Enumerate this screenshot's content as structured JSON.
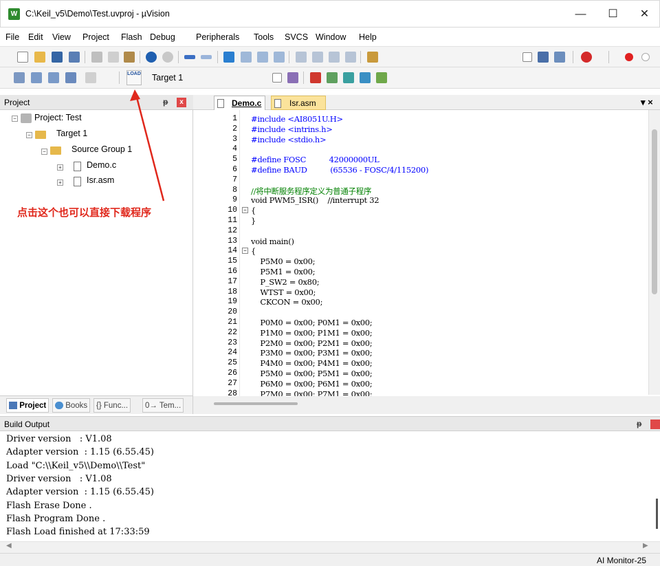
{
  "window": {
    "title": "C:\\Keil_v5\\Demo\\Test.uvproj - µVision",
    "app_icon_label": "W",
    "minimize": "—",
    "maximize": "☐",
    "close": "✕"
  },
  "menu": [
    "File",
    "Edit",
    "View",
    "Project",
    "Flash",
    "Debug",
    "Peripherals",
    "Tools",
    "SVCS",
    "Window",
    "Help"
  ],
  "toolbar2": {
    "load_icon_label": "LOAD",
    "target": "Target 1"
  },
  "project_panel": {
    "header": "Project",
    "pin": "ᵽ",
    "close": "x",
    "tree": {
      "project": "Project: Test",
      "target": "Target 1",
      "group": "Source Group 1",
      "files": [
        "Demo.c",
        "Isr.asm"
      ]
    },
    "tabs": [
      "Project",
      "Books",
      "{} Func...",
      "0→ Tem..."
    ]
  },
  "annotation": "点击这个也可以直接下载程序",
  "editor": {
    "tabs": [
      "Demo.c",
      "Isr.asm"
    ],
    "tab_menu": "▾ ×",
    "lines": [
      {
        "n": "1",
        "t": "#include <AI8051U.H>"
      },
      {
        "n": "2",
        "t": "#include <intrins.h>"
      },
      {
        "n": "3",
        "t": "#include <stdio.h>"
      },
      {
        "n": "4",
        "t": ""
      },
      {
        "n": "5",
        "t": "#define FOSC          42000000UL"
      },
      {
        "n": "6",
        "t": "#define BAUD          (65536 - FOSC/4/115200)"
      },
      {
        "n": "7",
        "t": ""
      },
      {
        "n": "8",
        "t": "//将中断服务程序定义为普通子程序"
      },
      {
        "n": "9",
        "t": "void PWM5_ISR()    //interrupt 32"
      },
      {
        "n": "10",
        "t": "{"
      },
      {
        "n": "11",
        "t": "}"
      },
      {
        "n": "12",
        "t": ""
      },
      {
        "n": "13",
        "t": "void main()"
      },
      {
        "n": "14",
        "t": "{"
      },
      {
        "n": "15",
        "t": "    P5M0 = 0x00;"
      },
      {
        "n": "16",
        "t": "    P5M1 = 0x00;"
      },
      {
        "n": "17",
        "t": "    P_SW2 = 0x80;"
      },
      {
        "n": "18",
        "t": "    WTST = 0x00;"
      },
      {
        "n": "19",
        "t": "    CKCON = 0x00;"
      },
      {
        "n": "20",
        "t": ""
      },
      {
        "n": "21",
        "t": "    P0M0 = 0x00; P0M1 = 0x00;"
      },
      {
        "n": "22",
        "t": "    P1M0 = 0x00; P1M1 = 0x00;"
      },
      {
        "n": "23",
        "t": "    P2M0 = 0x00; P2M1 = 0x00;"
      },
      {
        "n": "24",
        "t": "    P3M0 = 0x00; P3M1 = 0x00;"
      },
      {
        "n": "25",
        "t": "    P4M0 = 0x00; P4M1 = 0x00;"
      },
      {
        "n": "26",
        "t": "    P5M0 = 0x00; P5M1 = 0x00;"
      },
      {
        "n": "27",
        "t": "    P6M0 = 0x00; P6M1 = 0x00;"
      },
      {
        "n": "28",
        "t": "    P7M0 = 0x00; P7M1 = 0x00;"
      }
    ]
  },
  "build_output": {
    "header": "Build Output",
    "lines": [
      "Driver version   : V1.08",
      "Adapter version  : 1.15 (6.55.45)",
      "Load \"C:\\\\Keil_v5\\\\Demo\\\\Test\"",
      "Driver version   : V1.08",
      "Adapter version  : 1.15 (6.55.45)",
      "Flash Erase Done .",
      "Flash Program Done .",
      "Flash Load finished at 17:33:59"
    ]
  },
  "status": {
    "debugger": "AI Monitor-25"
  },
  "colors": {
    "annotation": "#e0281c",
    "keyword": "#0000ff",
    "comment": "#008000",
    "number": "#008080",
    "preproc": "#0000ff"
  }
}
